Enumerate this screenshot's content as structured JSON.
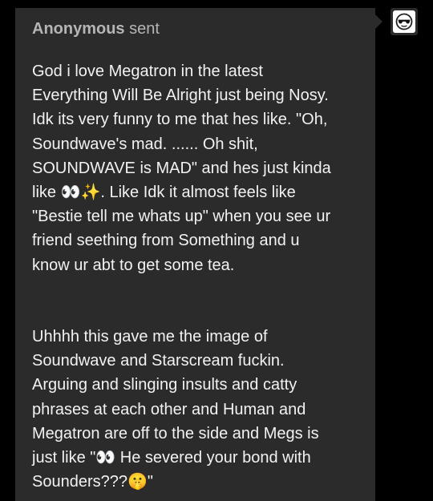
{
  "ask": {
    "asker_name": "Anonymous",
    "sent_label": "sent",
    "question": "God i love Megatron in the latest\nEverything Will Be Alright just being Nosy.\nIdk its very funny to me that hes like. \"Oh,\nSoundwave's mad. ...... Oh shit,\nSOUNDWAVE is MAD\" and hes just kinda\nlike 👀✨. Like Idk it almost feels like\n\"Bestie tell me whats up\" when you see ur\nfriend seething from Something and u\nknow ur abt to get some tea."
  },
  "reply": {
    "text": "Uhhhh this gave me the image of\nSoundwave and Starscream fuckin.\nArguing and slinging insults and catty\nphrases at each other and Human and\nMegatron are off to the side and Megs is\njust like \"👀 He severed your bond with\nSounders???🤫\""
  },
  "avatar": {
    "icon": "anonymous-sunglasses-icon"
  },
  "colors": {
    "page_background": "#000000",
    "card_background": "#2b2b2b",
    "header_text": "#b5b5b5",
    "body_text": "#f2f2f2"
  }
}
